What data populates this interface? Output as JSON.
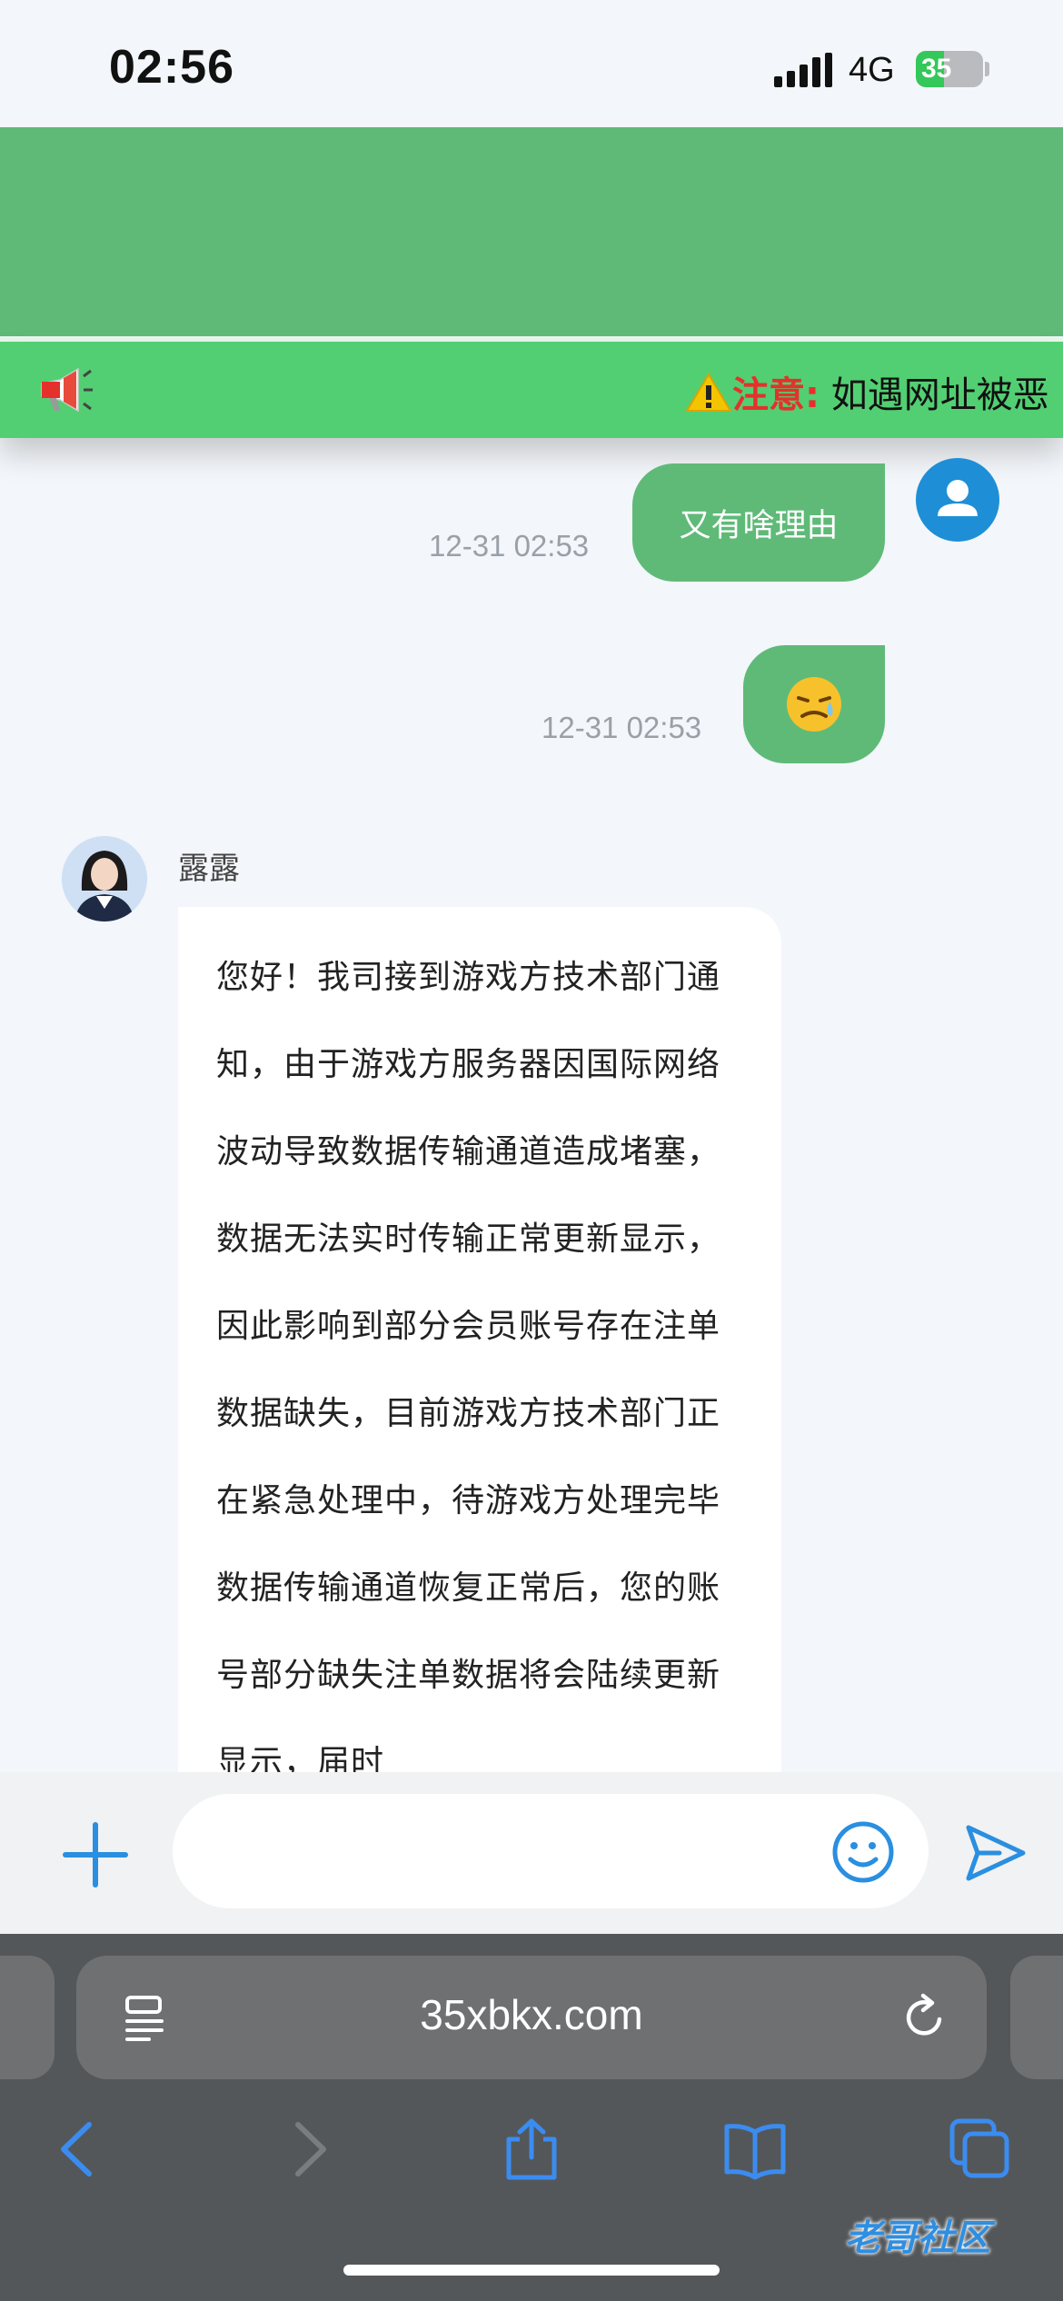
{
  "status_bar": {
    "time": "02:56",
    "network": "4G",
    "battery": "35",
    "battery_level": 0.35
  },
  "notice": {
    "label": "注意:",
    "text": "如遇网址被恶"
  },
  "messages": [
    {
      "text": "又有啥理由",
      "time": "12-31 02:53"
    },
    {
      "emoji": "😓",
      "time": "12-31 02:53"
    }
  ],
  "agent": {
    "name": "露露",
    "message": "您好！我司接到游戏方技术部门通知，由于游戏方服务器因国际网络波动导致数据传输通道造成堵塞，数据无法实时传输正常更新显示，因此影响到部分会员账号存在注单数据缺失，目前游戏方技术部门正在紧急处理中，待游戏方处理完毕数据传输通道恢复正常后，您的账号部分缺失注单数据将会陆续更新显示，届时"
  },
  "input": {
    "placeholder": ""
  },
  "browser": {
    "url": "35xbkx.com"
  },
  "watermark": "老哥社区",
  "colors": {
    "header": "#5fba78",
    "ticker": "#52cf72",
    "bubble": "#5fba78",
    "accent": "#1e8fd6",
    "notice_label": "#e5312b"
  }
}
